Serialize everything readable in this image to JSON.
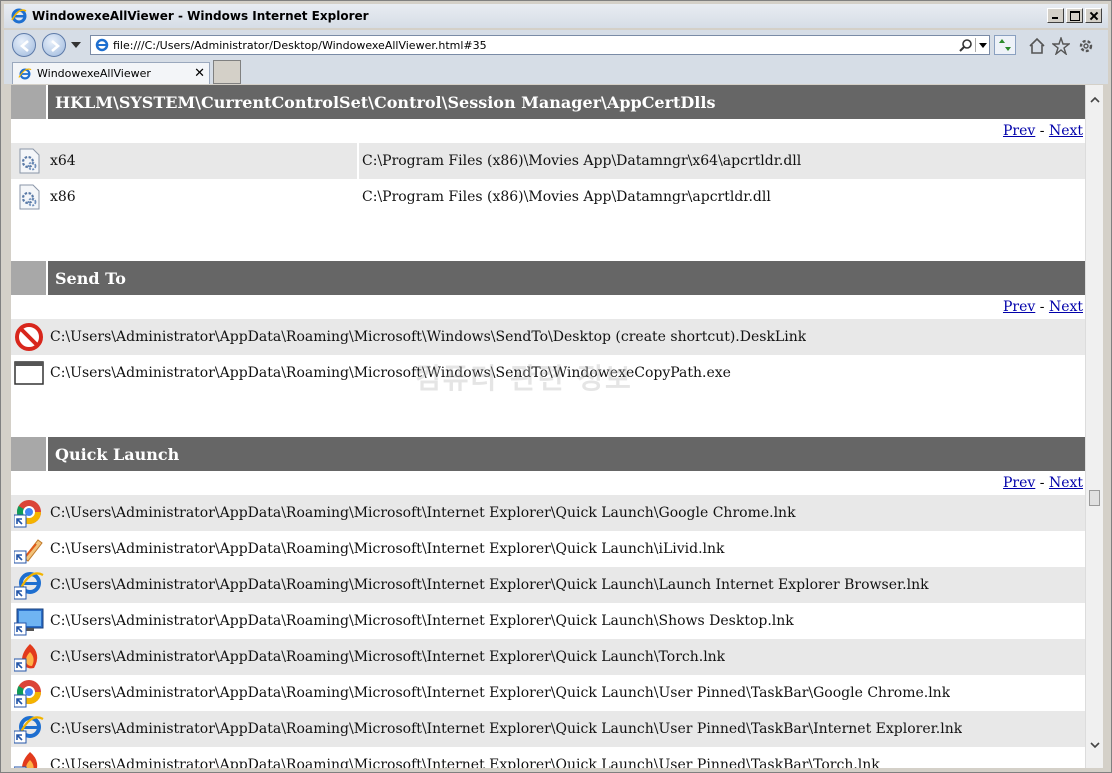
{
  "window": {
    "title": "WindowexeAllViewer - Windows Internet Explorer"
  },
  "navbar": {
    "url": "file:///C:/Users/Administrator/Desktop/WindowexeAllViewer.html#35"
  },
  "tabs": [
    {
      "label": "WindowexeAllViewer",
      "close": "✕"
    }
  ],
  "pager": {
    "prev": "Prev",
    "separator": " - ",
    "next": "Next"
  },
  "sections": [
    {
      "title": "HKLM\\SYSTEM\\CurrentControlSet\\Control\\Session Manager\\AppCertDlls",
      "rows": [
        {
          "icon": "dll-settings-icon",
          "name": "x64",
          "value": "C:\\Program Files (x86)\\Movies App\\Datamngr\\x64\\apcrtldr.dll"
        },
        {
          "icon": "dll-settings-icon",
          "name": "x86",
          "value": "C:\\Program Files (x86)\\Movies App\\Datamngr\\apcrtldr.dll"
        }
      ]
    },
    {
      "title": "Send To",
      "rows": [
        {
          "icon": "blocked-icon",
          "path": "C:\\Users\\Administrator\\AppData\\Roaming\\Microsoft\\Windows\\SendTo\\Desktop (create shortcut).DeskLink"
        },
        {
          "icon": "window-icon",
          "path": "C:\\Users\\Administrator\\AppData\\Roaming\\Microsoft\\Windows\\SendTo\\WindowexeCopyPath.exe"
        }
      ]
    },
    {
      "title": "Quick Launch",
      "rows": [
        {
          "icon": "chrome-shortcut-icon",
          "path": "C:\\Users\\Administrator\\AppData\\Roaming\\Microsoft\\Internet Explorer\\Quick Launch\\Google Chrome.lnk"
        },
        {
          "icon": "ilivid-shortcut-icon",
          "path": "C:\\Users\\Administrator\\AppData\\Roaming\\Microsoft\\Internet Explorer\\Quick Launch\\iLivid.lnk"
        },
        {
          "icon": "ie-shortcut-icon",
          "path": "C:\\Users\\Administrator\\AppData\\Roaming\\Microsoft\\Internet Explorer\\Quick Launch\\Launch Internet Explorer Browser.lnk"
        },
        {
          "icon": "desktop-shortcut-icon",
          "path": "C:\\Users\\Administrator\\AppData\\Roaming\\Microsoft\\Internet Explorer\\Quick Launch\\Shows Desktop.lnk"
        },
        {
          "icon": "torch-shortcut-icon",
          "path": "C:\\Users\\Administrator\\AppData\\Roaming\\Microsoft\\Internet Explorer\\Quick Launch\\Torch.lnk"
        },
        {
          "icon": "chrome-shortcut-icon",
          "path": "C:\\Users\\Administrator\\AppData\\Roaming\\Microsoft\\Internet Explorer\\Quick Launch\\User Pinned\\TaskBar\\Google Chrome.lnk"
        },
        {
          "icon": "ie-shortcut-icon",
          "path": "C:\\Users\\Administrator\\AppData\\Roaming\\Microsoft\\Internet Explorer\\Quick Launch\\User Pinned\\TaskBar\\Internet Explorer.lnk"
        },
        {
          "icon": "torch-shortcut-icon",
          "path": "C:\\Users\\Administrator\\AppData\\Roaming\\Microsoft\\Internet Explorer\\Quick Launch\\User Pinned\\TaskBar\\Torch.lnk"
        }
      ]
    }
  ],
  "watermark": "컴퓨터 관련 정보"
}
